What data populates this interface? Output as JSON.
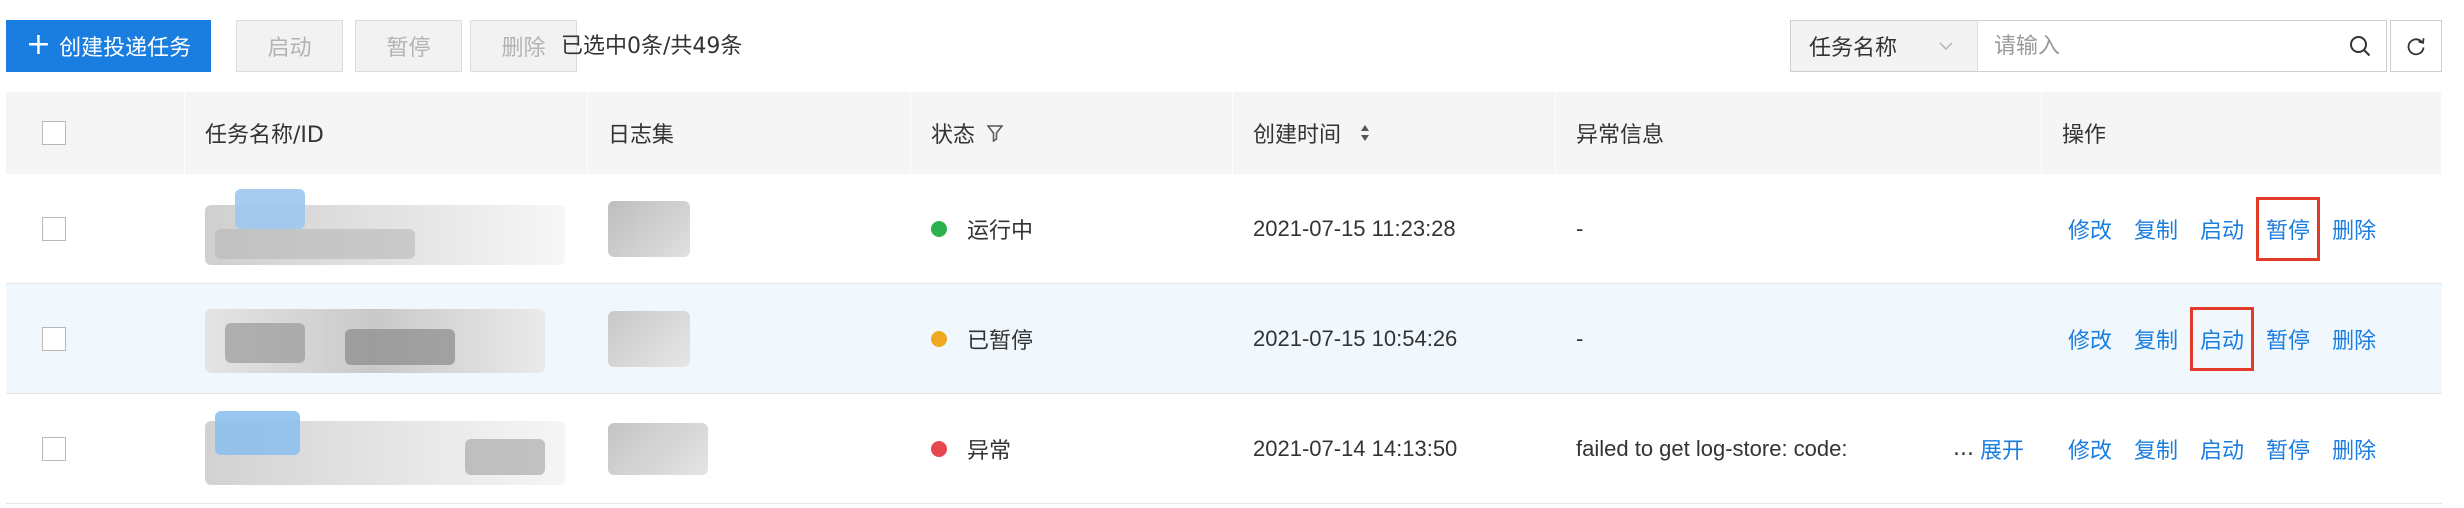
{
  "toolbar": {
    "create_label": "创建投递任务",
    "start_label": "启动",
    "pause_label": "暂停",
    "delete_label": "删除",
    "selection_info": "已选中0条/共49条",
    "search_field": "任务名称",
    "search_placeholder": "请输入"
  },
  "table": {
    "headers": {
      "name": "任务名称/ID",
      "logset": "日志集",
      "status": "状态",
      "created": "创建时间",
      "error": "异常信息",
      "actions": "操作"
    },
    "rows": [
      {
        "status": "运行中",
        "status_color": "#2bb24c",
        "created": "2021-07-15 11:23:28",
        "error": "-",
        "expand": ""
      },
      {
        "status": "已暂停",
        "status_color": "#f0a820",
        "created": "2021-07-15 10:54:26",
        "error": "-",
        "expand": ""
      },
      {
        "status": "异常",
        "status_color": "#e5484d",
        "created": "2021-07-14 14:13:50",
        "error": "failed to get log-store: code:",
        "expand": "展开"
      }
    ],
    "actions": {
      "edit": "修改",
      "copy": "复制",
      "start": "启动",
      "pause": "暂停",
      "delete": "删除"
    },
    "ellipsis": "..."
  },
  "colors": {
    "primary": "#1a7de0",
    "highlight": "#e23b2a",
    "header_bg": "#f5f5f5",
    "selected_row_bg": "#f0f8fe"
  }
}
